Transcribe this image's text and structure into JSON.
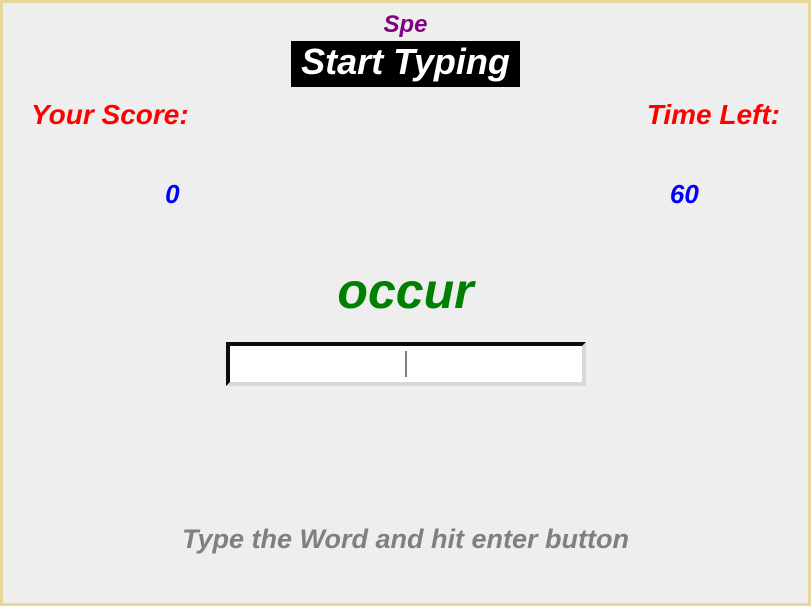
{
  "header": {
    "spe": "Spe",
    "start_typing": "Start Typing"
  },
  "score": {
    "label": "Your Score:",
    "value": "0"
  },
  "time": {
    "label": "Time Left:",
    "value": "60"
  },
  "word": {
    "current": "occur"
  },
  "input": {
    "value": ""
  },
  "instruction": "Type the Word and hit enter button"
}
